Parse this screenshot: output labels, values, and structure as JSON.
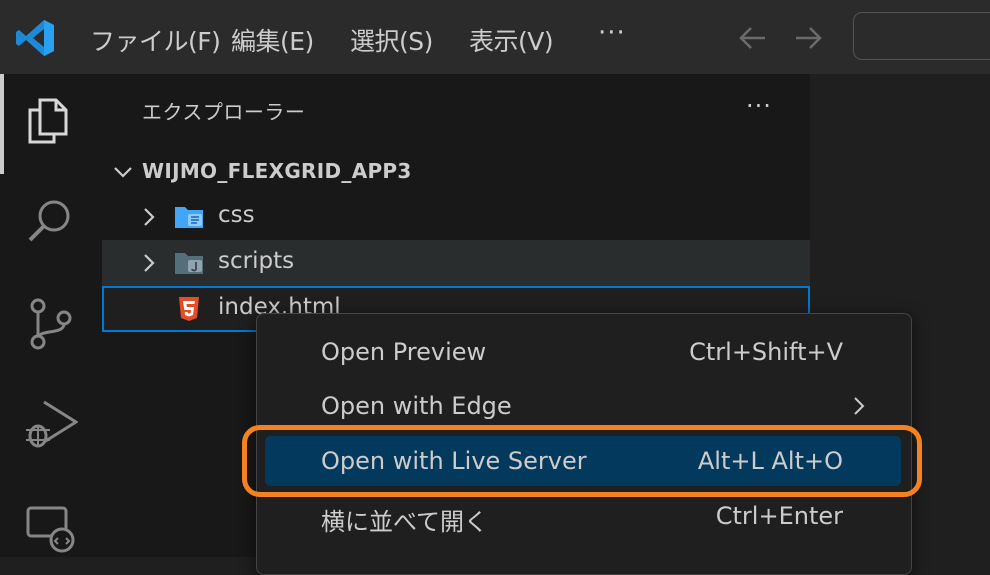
{
  "titlebar": {
    "menus": [
      "ファイル(F)",
      "編集(E)",
      "選択(S)",
      "表示(V)"
    ],
    "more": "···"
  },
  "sidebar": {
    "title": "エクスプローラー",
    "more": "···",
    "project": "WIJMO_FLEXGRID_APP3",
    "items": [
      {
        "label": "css",
        "icon": "css-folder-icon"
      },
      {
        "label": "scripts",
        "icon": "scripts-folder-icon"
      },
      {
        "label": "index.html",
        "icon": "html5-file-icon"
      }
    ]
  },
  "context_menu": {
    "items": [
      {
        "label": "Open Preview",
        "shortcut": "Ctrl+Shift+V"
      },
      {
        "label": "Open with Edge",
        "shortcut": ""
      },
      {
        "label": "Open with Live Server",
        "shortcut": "Alt+L Alt+O"
      },
      {
        "label": "横に並べて開く",
        "shortcut": "Ctrl+Enter"
      }
    ]
  },
  "colors": {
    "accent": "#0078d4",
    "highlight_ring": "#f58220",
    "menu_selection": "#04395e"
  }
}
